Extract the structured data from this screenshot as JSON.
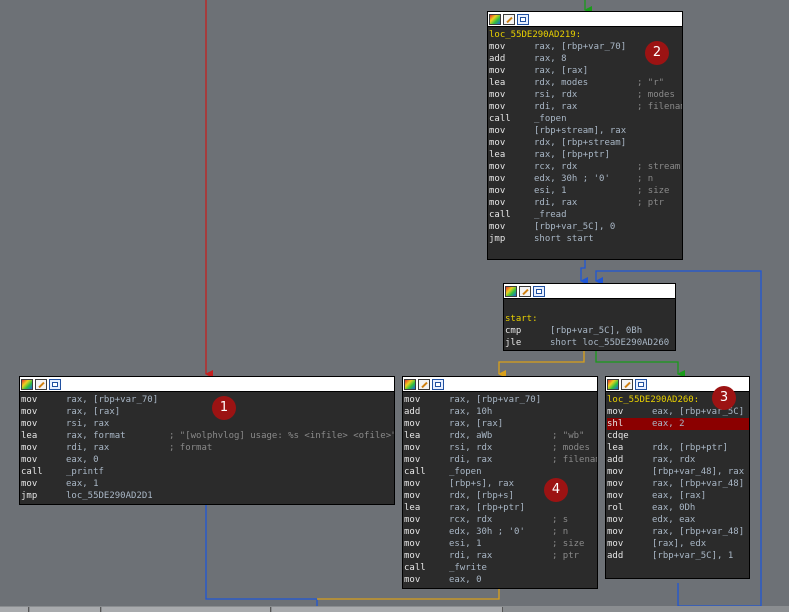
{
  "blocks": [
    {
      "id": "blk2",
      "lines": [
        {
          "label": "loc_55DE290AD219:"
        },
        {
          "m": "mov",
          "o": "rax, [rbp+var_70]"
        },
        {
          "m": "add",
          "o": "rax, 8"
        },
        {
          "m": "mov",
          "o": "rax, [rax]"
        },
        {
          "m": "lea",
          "o": "rdx, modes",
          "c": "; \"r\""
        },
        {
          "m": "mov",
          "o": "rsi, rdx",
          "c": "; modes"
        },
        {
          "m": "mov",
          "o": "rdi, rax",
          "c": "; filename"
        },
        {
          "m": "call",
          "o": "_fopen"
        },
        {
          "m": "mov",
          "o": "[rbp+stream], rax"
        },
        {
          "m": "mov",
          "o": "rdx, [rbp+stream]"
        },
        {
          "m": "lea",
          "o": "rax, [rbp+ptr]"
        },
        {
          "m": "mov",
          "o": "rcx, rdx",
          "c": "; stream"
        },
        {
          "m": "mov",
          "o": "edx, 30h ; '0'",
          "c": "; n"
        },
        {
          "m": "mov",
          "o": "esi, 1",
          "c": "; size"
        },
        {
          "m": "mov",
          "o": "rdi, rax",
          "c": "; ptr"
        },
        {
          "m": "call",
          "o": "_fread"
        },
        {
          "m": "mov",
          "o": "[rbp+var_5C], 0"
        },
        {
          "m": "jmp",
          "o": "short start"
        }
      ]
    },
    {
      "id": "blkstart",
      "lines": [
        {
          "blank": true
        },
        {
          "label": "start:"
        },
        {
          "m": "cmp",
          "o": "[rbp+var_5C], 0Bh"
        },
        {
          "m": "jle",
          "o": "short loc_55DE290AD260"
        }
      ]
    },
    {
      "id": "blk1",
      "lines": [
        {
          "m": "mov",
          "o": "rax, [rbp+var_70]"
        },
        {
          "m": "mov",
          "o": "rax, [rax]"
        },
        {
          "m": "mov",
          "o": "rsi, rax"
        },
        {
          "m": "lea",
          "o": "rax, format",
          "c": "; \"[wolphvlog] usage: %s <infile> <ofile>\""
        },
        {
          "m": "mov",
          "o": "rdi, rax",
          "c": "; format"
        },
        {
          "m": "mov",
          "o": "eax, 0"
        },
        {
          "m": "call",
          "o": "_printf"
        },
        {
          "m": "mov",
          "o": "eax, 1"
        },
        {
          "m": "jmp",
          "o": "loc_55DE290AD2D1"
        }
      ]
    },
    {
      "id": "blk4",
      "lines": [
        {
          "m": "mov",
          "o": "rax, [rbp+var_70]"
        },
        {
          "m": "add",
          "o": "rax, 10h"
        },
        {
          "m": "mov",
          "o": "rax, [rax]"
        },
        {
          "m": "lea",
          "o": "rdx, aWb",
          "c": "; \"wb\""
        },
        {
          "m": "mov",
          "o": "rsi, rdx",
          "c": "; modes"
        },
        {
          "m": "mov",
          "o": "rdi, rax",
          "c": "; filename"
        },
        {
          "m": "call",
          "o": "_fopen"
        },
        {
          "m": "mov",
          "o": "[rbp+s], rax"
        },
        {
          "m": "mov",
          "o": "rdx, [rbp+s]"
        },
        {
          "m": "lea",
          "o": "rax, [rbp+ptr]"
        },
        {
          "m": "mov",
          "o": "rcx, rdx",
          "c": "; s"
        },
        {
          "m": "mov",
          "o": "edx, 30h ; '0'",
          "c": "; n"
        },
        {
          "m": "mov",
          "o": "esi, 1",
          "c": "; size"
        },
        {
          "m": "mov",
          "o": "rdi, rax",
          "c": "; ptr"
        },
        {
          "m": "call",
          "o": "_fwrite"
        },
        {
          "m": "mov",
          "o": "eax, 0"
        }
      ]
    },
    {
      "id": "blk3",
      "lines": [
        {
          "label": "loc_55DE290AD260:"
        },
        {
          "m": "mov",
          "o": "eax, [rbp+var_5C]"
        },
        {
          "m": "shl",
          "o": "eax, 2",
          "hl": true
        },
        {
          "m": "cdqe",
          "o": ""
        },
        {
          "m": "lea",
          "o": "rdx, [rbp+ptr]"
        },
        {
          "m": "add",
          "o": "rax, rdx"
        },
        {
          "m": "mov",
          "o": "[rbp+var_48], rax"
        },
        {
          "m": "mov",
          "o": "rax, [rbp+var_48]"
        },
        {
          "m": "mov",
          "o": "eax, [rax]"
        },
        {
          "m": "rol",
          "o": "eax, 0Dh"
        },
        {
          "m": "mov",
          "o": "edx, eax"
        },
        {
          "m": "mov",
          "o": "rax, [rbp+var_48]"
        },
        {
          "m": "mov",
          "o": "[rax], edx"
        },
        {
          "m": "add",
          "o": "[rbp+var_5C], 1"
        }
      ]
    }
  ],
  "markers": {
    "m1": "1",
    "m2": "2",
    "m3": "3",
    "m4": "4"
  },
  "colors": {
    "background": "#6d7176",
    "block_bg": "#2b2b2b",
    "label": "#e8d000",
    "mnemonic": "#e6e6e6",
    "operand": "#a9b7c6",
    "comment": "#8a8a8a",
    "highlight": "#8b0000",
    "marker": "#9c1313",
    "edge_true": "#1a9b1a",
    "edge_false": "#d9a01b",
    "edge_jump": "#1f56d6",
    "edge_red": "#c41f1f"
  }
}
